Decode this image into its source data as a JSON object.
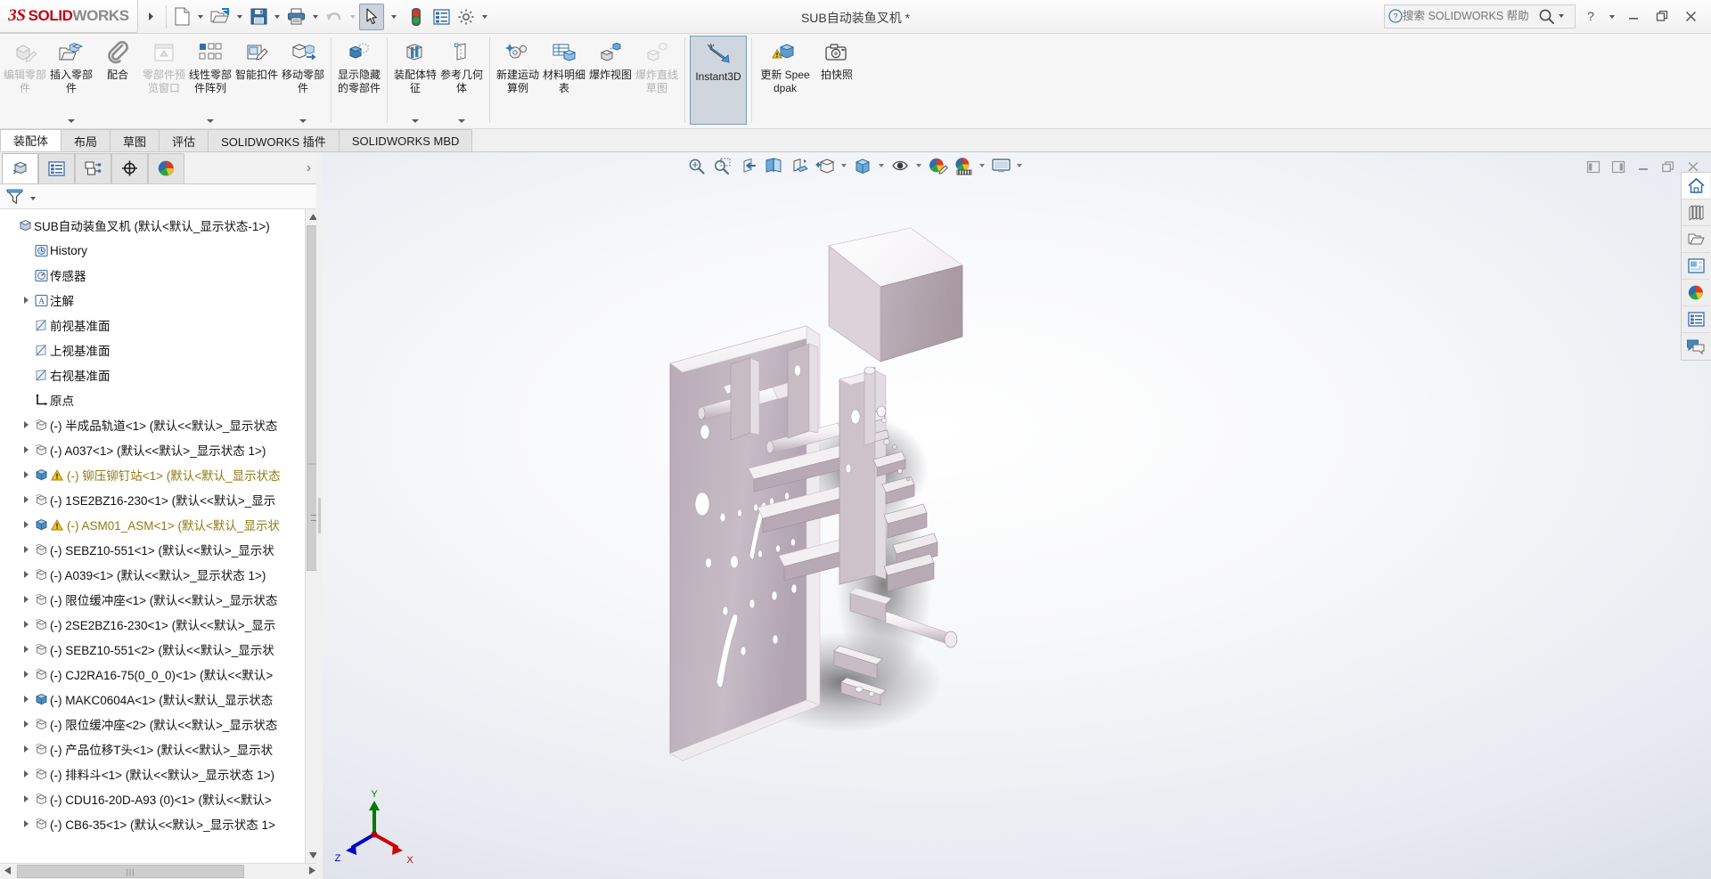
{
  "app": {
    "brand_mark": "3S",
    "brand_solid": "SOLID",
    "brand_works": "WORKS",
    "document_title": "SUB自动装鱼叉机 *",
    "accent_red": "#c00418",
    "accent_blue": "#3a6ea5"
  },
  "quick_access": {
    "expand_tooltip": "▶",
    "items": [
      {
        "name": "new-document",
        "icon": "new-doc-icon",
        "has_dropdown": true,
        "disabled": false
      },
      {
        "name": "open-document",
        "icon": "open-folder-icon",
        "has_dropdown": true,
        "disabled": false
      },
      {
        "name": "save-document",
        "icon": "save-disk-icon",
        "has_dropdown": true,
        "disabled": false
      },
      {
        "name": "print-document",
        "icon": "printer-icon",
        "has_dropdown": true,
        "disabled": false
      },
      {
        "name": "undo",
        "icon": "undo-arrow-icon",
        "has_dropdown": true,
        "disabled": true
      },
      {
        "name": "select",
        "icon": "cursor-arrow-icon",
        "has_dropdown": true,
        "disabled": false,
        "pressed": true
      },
      {
        "name": "rebuild",
        "icon": "traffic-light-icon",
        "has_dropdown": false,
        "disabled": false
      },
      {
        "name": "file-properties",
        "icon": "properties-list-icon",
        "has_dropdown": false,
        "disabled": false
      },
      {
        "name": "options",
        "icon": "gear-icon",
        "has_dropdown": true,
        "disabled": false
      }
    ]
  },
  "help_search": {
    "placeholder": "搜索 SOLIDWORKS 帮助",
    "value": "",
    "icon": "question-circle-icon",
    "search_icon": "magnifier-icon"
  },
  "window_controls": {
    "help": "?",
    "minimize": "—",
    "restore": "❐",
    "close": "✕"
  },
  "ribbon": {
    "groups": [
      {
        "commands": [
          {
            "label": "编辑零部件",
            "icon": "edit-component-icon",
            "disabled": true,
            "dropdown": false
          },
          {
            "label": "插入零部件",
            "icon": "insert-component-icon",
            "disabled": false,
            "dropdown": true
          },
          {
            "label": "配合",
            "icon": "mate-paperclip-icon",
            "disabled": false,
            "dropdown": false
          },
          {
            "label": "零部件预览窗口",
            "icon": "component-preview-icon",
            "disabled": true,
            "dropdown": false
          },
          {
            "label": "线性零部件阵列",
            "icon": "linear-pattern-icon",
            "disabled": false,
            "dropdown": true
          },
          {
            "label": "智能扣件",
            "icon": "smart-fastener-icon",
            "disabled": false,
            "dropdown": false
          },
          {
            "label": "移动零部件",
            "icon": "move-component-icon",
            "disabled": false,
            "dropdown": true
          }
        ]
      },
      {
        "commands": [
          {
            "label": "显示隐藏的零部件",
            "icon": "show-hidden-components-icon",
            "disabled": false,
            "dropdown": false
          }
        ]
      },
      {
        "commands": [
          {
            "label": "装配体特征",
            "icon": "assembly-feature-icon",
            "disabled": false,
            "dropdown": true
          },
          {
            "label": "参考几何体",
            "icon": "reference-geometry-icon",
            "disabled": false,
            "dropdown": true
          }
        ]
      },
      {
        "commands": [
          {
            "label": "新建运动算例",
            "icon": "new-motion-study-icon",
            "disabled": false,
            "dropdown": false
          },
          {
            "label": "材料明细表",
            "icon": "bill-of-materials-icon",
            "disabled": false,
            "dropdown": false
          },
          {
            "label": "爆炸视图",
            "icon": "exploded-view-icon",
            "disabled": false,
            "dropdown": false
          },
          {
            "label": "爆炸直线草图",
            "icon": "explode-line-sketch-icon",
            "disabled": true,
            "dropdown": false
          }
        ]
      },
      {
        "commands": [
          {
            "label": "Instant3D",
            "icon": "instant3d-icon",
            "disabled": false,
            "dropdown": false,
            "active": true
          }
        ]
      },
      {
        "commands": [
          {
            "label": "更新 Speedpak",
            "icon": "update-speedpak-icon",
            "disabled": false,
            "dropdown": false
          },
          {
            "label": "拍快照",
            "icon": "camera-snapshot-icon",
            "disabled": false,
            "dropdown": false
          }
        ]
      }
    ]
  },
  "tabs": [
    {
      "label": "装配体",
      "selected": true
    },
    {
      "label": "布局",
      "selected": false
    },
    {
      "label": "草图",
      "selected": false
    },
    {
      "label": "评估",
      "selected": false
    },
    {
      "label": "SOLIDWORKS 插件",
      "selected": false
    },
    {
      "label": "SOLIDWORKS MBD",
      "selected": false
    }
  ],
  "manager_tabs": [
    {
      "name": "feature-manager-tab",
      "icon": "feature-tree-cube-icon",
      "selected": true
    },
    {
      "name": "property-manager-tab",
      "icon": "property-list-icon",
      "selected": false
    },
    {
      "name": "configuration-manager-tab",
      "icon": "configuration-icon",
      "selected": false
    },
    {
      "name": "dimxpert-manager-tab",
      "icon": "dimxpert-target-icon",
      "selected": false
    },
    {
      "name": "display-manager-tab",
      "icon": "appearance-sphere-icon",
      "selected": false
    }
  ],
  "filter_bar": {
    "icon": "filter-funnel-icon",
    "has_dropdown": true
  },
  "tree": {
    "root": {
      "label": "SUB自动装鱼叉机  (默认<默认_显示状态-1>)",
      "icon": "assembly-cube-icon",
      "indent": 0,
      "twisty": false,
      "warn": false
    },
    "items": [
      {
        "label": "History",
        "icon": "history-icon",
        "indent": 1,
        "twisty": false,
        "warn": false
      },
      {
        "label": "传感器",
        "icon": "sensor-icon",
        "indent": 1,
        "twisty": false,
        "warn": false
      },
      {
        "label": "注解",
        "icon": "annotation-icon",
        "indent": 1,
        "twisty": true,
        "warn": false
      },
      {
        "label": "前视基准面",
        "icon": "plane-icon",
        "indent": 1,
        "twisty": false,
        "warn": false
      },
      {
        "label": "上视基准面",
        "icon": "plane-icon",
        "indent": 1,
        "twisty": false,
        "warn": false
      },
      {
        "label": "右视基准面",
        "icon": "plane-icon",
        "indent": 1,
        "twisty": false,
        "warn": false
      },
      {
        "label": "原点",
        "icon": "origin-icon",
        "indent": 1,
        "twisty": false,
        "warn": false
      },
      {
        "label": "(-) 半成品轨道<1>  (默认<<默认>_显示状态",
        "icon": "component-icon",
        "indent": 1,
        "twisty": true,
        "warn": false
      },
      {
        "label": "(-) A037<1>  (默认<<默认>_显示状态 1>)",
        "icon": "component-icon",
        "indent": 1,
        "twisty": true,
        "warn": false
      },
      {
        "label": "(-) 铆压铆钉站<1>  (默认<默认_显示状态",
        "icon": "subassembly-icon",
        "indent": 1,
        "twisty": true,
        "warn": true
      },
      {
        "label": "(-) 1SE2BZ16-230<1>  (默认<<默认>_显示",
        "icon": "component-icon",
        "indent": 1,
        "twisty": true,
        "warn": false
      },
      {
        "label": "(-) ASM01_ASM<1>  (默认<默认_显示状",
        "icon": "subassembly-icon",
        "indent": 1,
        "twisty": true,
        "warn": true
      },
      {
        "label": "(-) SEBZ10-551<1>  (默认<<默认>_显示状",
        "icon": "component-icon",
        "indent": 1,
        "twisty": true,
        "warn": false
      },
      {
        "label": "(-) A039<1>  (默认<<默认>_显示状态 1>)",
        "icon": "component-icon",
        "indent": 1,
        "twisty": true,
        "warn": false
      },
      {
        "label": "(-) 限位缓冲座<1>  (默认<<默认>_显示状态",
        "icon": "component-icon",
        "indent": 1,
        "twisty": true,
        "warn": false
      },
      {
        "label": "(-) 2SE2BZ16-230<1>  (默认<<默认>_显示",
        "icon": "component-icon",
        "indent": 1,
        "twisty": true,
        "warn": false
      },
      {
        "label": "(-) SEBZ10-551<2>  (默认<<默认>_显示状",
        "icon": "component-icon",
        "indent": 1,
        "twisty": true,
        "warn": false
      },
      {
        "label": "(-) CJ2RA16-75(0_0_0)<1>  (默认<<默认>",
        "icon": "component-icon",
        "indent": 1,
        "twisty": true,
        "warn": false
      },
      {
        "label": "(-) MAKC0604A<1>  (默认<默认_显示状态",
        "icon": "subassembly-icon",
        "indent": 1,
        "twisty": true,
        "warn": false
      },
      {
        "label": "(-) 限位缓冲座<2>  (默认<<默认>_显示状态",
        "icon": "component-icon",
        "indent": 1,
        "twisty": true,
        "warn": false
      },
      {
        "label": "(-) 产品位移T头<1>  (默认<<默认>_显示状",
        "icon": "component-icon",
        "indent": 1,
        "twisty": true,
        "warn": false
      },
      {
        "label": "(-) 排料斗<1>  (默认<<默认>_显示状态 1>)",
        "icon": "component-icon",
        "indent": 1,
        "twisty": true,
        "warn": false
      },
      {
        "label": "(-) CDU16-20D-A93 (0)<1>  (默认<<默认>",
        "icon": "component-icon",
        "indent": 1,
        "twisty": true,
        "warn": false
      },
      {
        "label": "(-) CB6-35<1>  (默认<<默认>_显示状态 1>",
        "icon": "component-icon",
        "indent": 1,
        "twisty": true,
        "warn": false
      }
    ]
  },
  "view_toolbar": [
    {
      "name": "zoom-to-fit-button",
      "icon": "zoom-fit-icon",
      "dropdown": false
    },
    {
      "name": "zoom-to-area-button",
      "icon": "zoom-area-icon",
      "dropdown": false
    },
    {
      "name": "previous-view-button",
      "icon": "previous-view-icon",
      "dropdown": false
    },
    {
      "name": "section-view-button",
      "icon": "section-view-icon",
      "dropdown": false
    },
    {
      "name": "view-orientation-button",
      "icon": "view-orientation-icon",
      "dropdown": false
    },
    {
      "name": "display-style-button",
      "icon": "display-style-icon",
      "dropdown": true
    },
    {
      "name": "hide-show-items-button",
      "icon": "hide-show-cube-icon",
      "dropdown": true
    },
    {
      "name": "view-settings-button",
      "icon": "eye-settings-icon",
      "dropdown": true
    },
    {
      "name": "apply-scene-button",
      "icon": "scene-sphere-icon",
      "dropdown": false
    },
    {
      "name": "appearances-button",
      "icon": "appearance-palette-icon",
      "dropdown": true
    },
    {
      "name": "viewport-button",
      "icon": "monitor-viewport-icon",
      "dropdown": true
    }
  ],
  "graphics_window_controls": [
    {
      "name": "restore-left-button",
      "icon": "dock-left-icon"
    },
    {
      "name": "restore-right-button",
      "icon": "dock-right-icon"
    },
    {
      "name": "minimize-doc-button",
      "icon": "minimize-icon"
    },
    {
      "name": "restore-doc-button",
      "icon": "restore-icon"
    },
    {
      "name": "close-doc-button",
      "icon": "close-icon"
    }
  ],
  "task_pane": [
    {
      "name": "solidworks-resources-button",
      "icon": "home-icon",
      "selected": true
    },
    {
      "name": "design-library-button",
      "icon": "library-books-icon",
      "selected": false
    },
    {
      "name": "file-explorer-button",
      "icon": "folder-icon",
      "selected": false
    },
    {
      "name": "view-palette-button",
      "icon": "view-palette-icon",
      "selected": false
    },
    {
      "name": "appearances-scenes-button",
      "icon": "appearance-sphere-icon",
      "selected": false
    },
    {
      "name": "custom-properties-button",
      "icon": "custom-properties-icon",
      "selected": false
    },
    {
      "name": "solidworks-forum-button",
      "icon": "forum-chat-icon",
      "selected": false
    }
  ],
  "triad": {
    "x_label": "X",
    "y_label": "Y",
    "z_label": "Z",
    "x_color": "#d00000",
    "y_color": "#007a00",
    "z_color": "#0000cc"
  },
  "model": {
    "description": "3D assembly of an automated fish-fork loading machine",
    "body_color": "#cbbfc9",
    "highlight_color": "#ffffff"
  }
}
